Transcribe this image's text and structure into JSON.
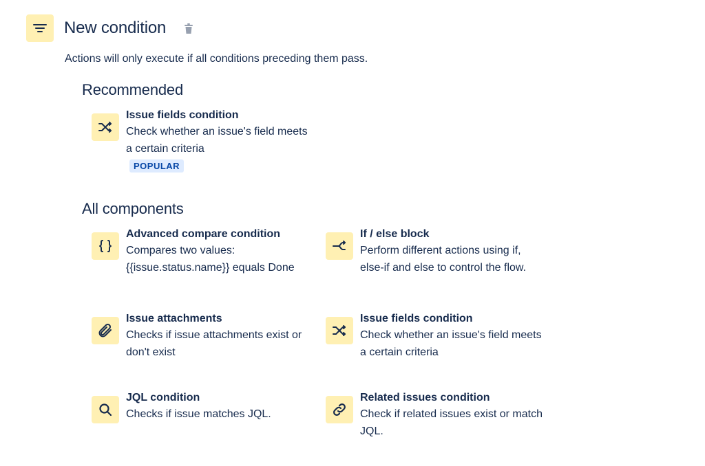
{
  "header": {
    "title": "New condition",
    "subtitle": "Actions will only execute if all conditions preceding them pass."
  },
  "recommended": {
    "heading": "Recommended",
    "items": [
      {
        "name": "Issue fields condition",
        "description": "Check whether an issue's field meets a certain criteria",
        "badge": "POPULAR",
        "icon": "shuffle-icon"
      }
    ]
  },
  "all_components": {
    "heading": "All components",
    "items": [
      {
        "name": "Advanced compare condition",
        "description": "Compares two values: {{issue.status.name}} equals Done",
        "icon": "braces-icon"
      },
      {
        "name": "If / else block",
        "description": "Perform different actions using if, else-if and else to control the flow.",
        "icon": "branch-icon"
      },
      {
        "name": "Issue attachments",
        "description": "Checks if issue attachments exist or don't exist",
        "icon": "paperclip-icon"
      },
      {
        "name": "Issue fields condition",
        "description": "Check whether an issue's field meets a certain criteria",
        "icon": "shuffle-icon"
      },
      {
        "name": "JQL condition",
        "description": "Checks if issue matches JQL.",
        "icon": "search-icon"
      },
      {
        "name": "Related issues condition",
        "description": "Check if related issues exist or match JQL.",
        "icon": "link-icon"
      }
    ]
  },
  "colors": {
    "icon_bg": "#fff0b3",
    "text": "#172b4d",
    "badge_bg": "#deebff",
    "badge_text": "#0747a6"
  }
}
